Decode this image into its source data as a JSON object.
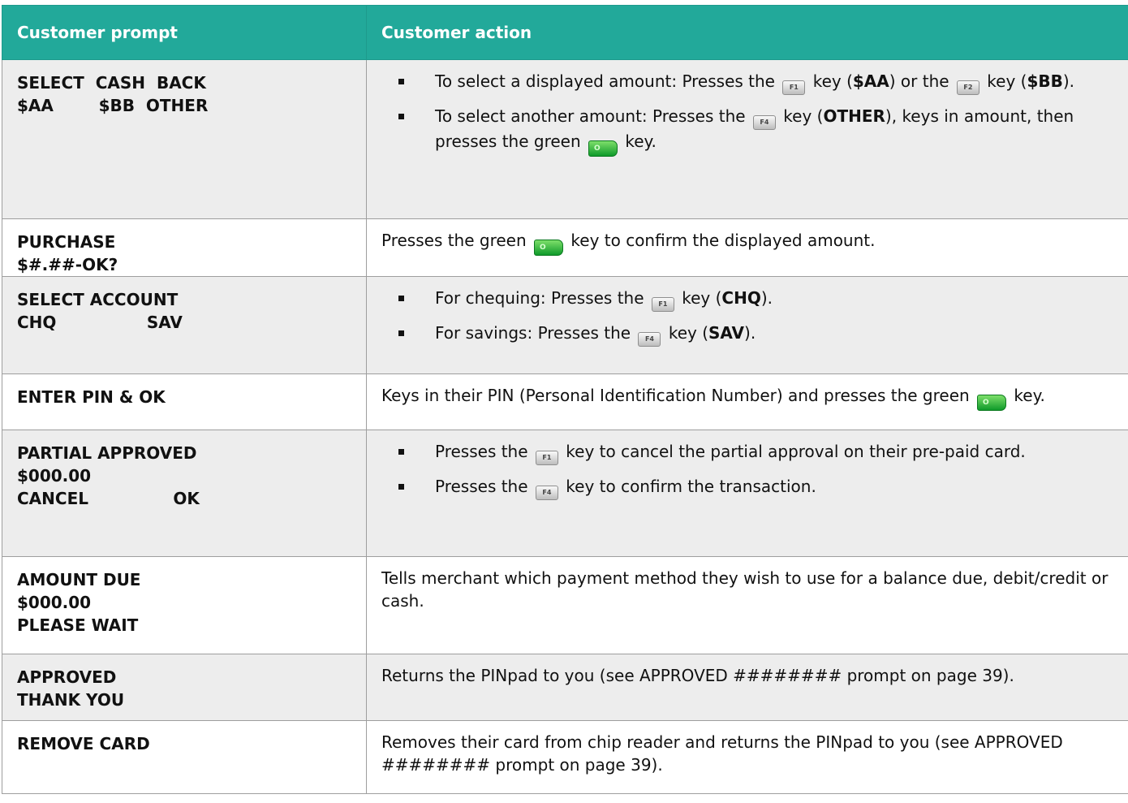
{
  "table": {
    "headers": [
      "Customer prompt",
      "Customer action"
    ],
    "rows": [
      {
        "prompt": [
          "SELECT  CASH  BACK",
          "$AA        $BB  OTHER"
        ],
        "bullets": [
          [
            {
              "t": "To select a displayed amount: Presses the "
            },
            {
              "key": "f1-key-icon",
              "label": "F1"
            },
            {
              "t": " key ("
            },
            {
              "b": "$AA"
            },
            {
              "t": ") or the "
            },
            {
              "key": "f2-key-icon",
              "label": "F2"
            },
            {
              "t": " key ("
            },
            {
              "b": "$BB"
            },
            {
              "t": ")."
            }
          ],
          [
            {
              "t": "To select another amount: Presses the "
            },
            {
              "key": "f4-key-icon",
              "label": "F4"
            },
            {
              "t": " key ("
            },
            {
              "b": "OTHER"
            },
            {
              "t": "), keys in amount, then presses the green "
            },
            {
              "key": "green-ok-key-icon",
              "label": "O"
            },
            {
              "t": " key."
            }
          ]
        ]
      },
      {
        "prompt": [
          "PURCHASE",
          "$#.##-OK?"
        ],
        "action": [
          {
            "t": "Presses the green "
          },
          {
            "key": "green-ok-key-icon",
            "label": "O"
          },
          {
            "t": " key to confirm the displayed amount."
          }
        ]
      },
      {
        "prompt": [
          "SELECT ACCOUNT",
          "CHQ                SAV"
        ],
        "bullets": [
          [
            {
              "t": "For chequing: Presses the "
            },
            {
              "key": "f1-key-icon",
              "label": "F1"
            },
            {
              "t": " key ("
            },
            {
              "b": "CHQ"
            },
            {
              "t": ")."
            }
          ],
          [
            {
              "t": "For savings: Presses the "
            },
            {
              "key": "f4-key-icon",
              "label": "F4"
            },
            {
              "t": " key ("
            },
            {
              "b": "SAV"
            },
            {
              "t": ")."
            }
          ]
        ]
      },
      {
        "prompt": [
          "ENTER PIN & OK"
        ],
        "action": [
          {
            "t": "Keys in their PIN (Personal Identification Number) and presses the green "
          },
          {
            "key": "green-ok-key-icon",
            "label": "O"
          },
          {
            "t": " key."
          }
        ]
      },
      {
        "prompt": [
          "PARTIAL APPROVED",
          "$000.00",
          "CANCEL               OK"
        ],
        "bullets": [
          [
            {
              "t": "Presses the "
            },
            {
              "key": "f1-key-icon",
              "label": "F1"
            },
            {
              "t": " key to cancel the partial approval on their pre-paid card."
            }
          ],
          [
            {
              "t": "Presses the "
            },
            {
              "key": "f4-key-icon",
              "label": "F4"
            },
            {
              "t": " key to confirm the transaction."
            }
          ]
        ]
      },
      {
        "prompt": [
          "AMOUNT DUE",
          "$000.00",
          "PLEASE WAIT"
        ],
        "action": [
          {
            "t": "Tells merchant which payment method they wish to use for a balance due, debit/credit or cash."
          }
        ]
      },
      {
        "prompt": [
          "APPROVED",
          "THANK YOU"
        ],
        "action": [
          {
            "t": "Returns the PINpad to you (see APPROVED ######## prompt on page 39)."
          }
        ]
      },
      {
        "prompt": [
          "REMOVE CARD"
        ],
        "action": [
          {
            "t": "Removes their card from chip reader and returns the PINpad to you (see APPROVED ######## prompt on page 39)."
          }
        ]
      }
    ]
  }
}
